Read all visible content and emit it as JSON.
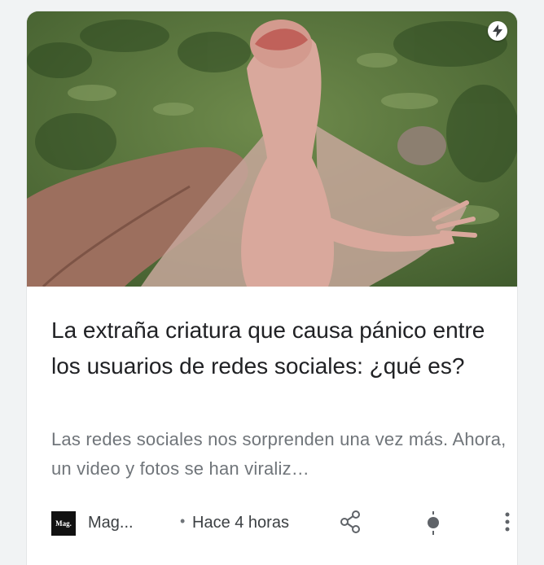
{
  "article": {
    "title": "La extraña criatura que causa pánico entre los usuarios de redes sociales: ¿qué es?",
    "snippet": "Las redes sociales nos sorprenden una vez más. Ahora, un video y fotos se han viraliz…",
    "image_icon": "amp-bolt-icon"
  },
  "footer": {
    "logo_text": "Mag.",
    "source": "Mag...",
    "separator": "•",
    "time": "Hace 4 horas",
    "icons": [
      "share-icon",
      "feed-interest-icon",
      "more-vert-icon"
    ]
  },
  "colors": {
    "title": "#202124",
    "snippet": "#70757a",
    "meta": "#3c4043",
    "icons": "#5f6368"
  }
}
